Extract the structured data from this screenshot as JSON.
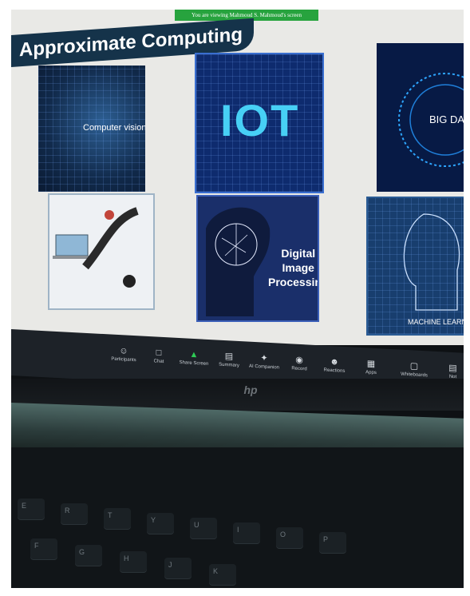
{
  "zoom_banner": "You are viewing Mahmoud S. Mahmoud's screen",
  "slide": {
    "title": "Approximate Computing",
    "tiles": [
      {
        "name": "computer-vision",
        "label": "Computer vision"
      },
      {
        "name": "iot",
        "label": "IOT"
      },
      {
        "name": "big-data",
        "label": "BIG DA"
      },
      {
        "name": "multimedia",
        "label": ""
      },
      {
        "name": "digital-image-processing",
        "label": "Digital\nImage\nProcessing"
      },
      {
        "name": "machine-learning",
        "label": "MACHINE LEARNING"
      }
    ]
  },
  "toolbar": {
    "items": [
      {
        "label": "Participants",
        "icon": "participants-icon"
      },
      {
        "label": "Chat",
        "icon": "chat-icon"
      },
      {
        "label": "Share Screen",
        "icon": "share-screen-icon"
      },
      {
        "label": "Summary",
        "icon": "summary-icon"
      },
      {
        "label": "AI Companion",
        "icon": "ai-companion-icon"
      },
      {
        "label": "Record",
        "icon": "record-icon"
      },
      {
        "label": "Reactions",
        "icon": "reactions-icon"
      },
      {
        "label": "Apps",
        "icon": "apps-icon"
      },
      {
        "label": "Whiteboards",
        "icon": "whiteboards-icon"
      },
      {
        "label": "Not",
        "icon": "notes-icon"
      }
    ]
  },
  "laptop_brand": "hp",
  "keys": [
    "E",
    "R",
    "T",
    "Y",
    "U",
    "I",
    "O",
    "P",
    "F",
    "G",
    "H",
    "J",
    "K"
  ]
}
